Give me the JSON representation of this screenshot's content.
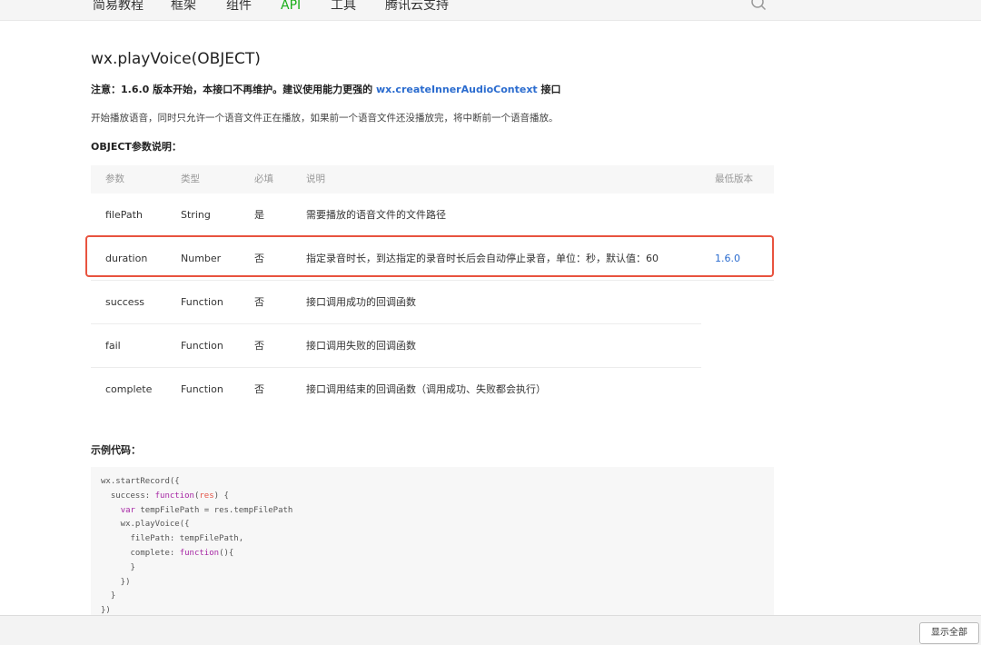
{
  "nav": {
    "items": [
      "简易教程",
      "框架",
      "组件",
      "API",
      "工具",
      "腾讯云支持"
    ],
    "active_index": 3,
    "icons": {
      "search": "search-icon"
    }
  },
  "page": {
    "title": "wx.playVoice(OBJECT)",
    "notice_prefix": "注意：1.6.0 版本开始，本接口不再维护。建议使用能力更强的 ",
    "notice_link": "wx.createInnerAudioContext",
    "notice_suffix": " 接口",
    "description": "开始播放语音，同时只允许一个语音文件正在播放，如果前一个语音文件还没播放完，将中断前一个语音播放。",
    "params_label": "OBJECT参数说明：",
    "example_label": "示例代码："
  },
  "table": {
    "headers": [
      "参数",
      "类型",
      "必填",
      "说明",
      "最低版本"
    ],
    "rows": [
      [
        "filePath",
        "String",
        "是",
        "需要播放的语音文件的文件路径",
        ""
      ],
      [
        "duration",
        "Number",
        "否",
        "指定录音时长，到达指定的录音时长后会自动停止录音，单位：秒，默认值：60",
        "1.6.0"
      ],
      [
        "success",
        "Function",
        "否",
        "接口调用成功的回调函数",
        ""
      ],
      [
        "fail",
        "Function",
        "否",
        "接口调用失败的回调函数",
        ""
      ],
      [
        "complete",
        "Function",
        "否",
        "接口调用结束的回调函数（调用成功、失败都会执行）",
        ""
      ]
    ],
    "highlighted_row": 1,
    "highlight_color": "#e8533f"
  },
  "code": {
    "l0": "wx.startRecord({",
    "l1_a": "  success: ",
    "l1_kw": "function",
    "l1_b": "(",
    "l1_arg": "res",
    "l1_c": ") {",
    "l2_a": "    ",
    "l2_kw": "var",
    "l2_b": " tempFilePath = res.tempFilePath",
    "l3": "    wx.playVoice({",
    "l4": "      filePath: tempFilePath,",
    "l5_a": "      complete: ",
    "l5_kw": "function",
    "l5_b": "(){",
    "l6": "      }",
    "l7": "    })",
    "l8": "  }",
    "l9": "})"
  },
  "bottom": {
    "show_all_label": "显示全部"
  },
  "colors": {
    "accent_green": "#1aad19",
    "link_blue": "#2b6ccf"
  }
}
